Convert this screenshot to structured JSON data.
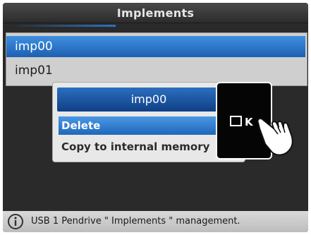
{
  "header": {
    "title": "Implements"
  },
  "list": {
    "items": [
      {
        "label": "imp00",
        "selected": true
      },
      {
        "label": "imp01",
        "selected": false
      }
    ]
  },
  "popup": {
    "title": "imp00",
    "options": [
      {
        "label": "Delete",
        "selected": true
      },
      {
        "label": "Copy to internal memory",
        "selected": false
      }
    ]
  },
  "ok_key": {
    "label": "K",
    "icon": "box-o-icon"
  },
  "status": {
    "icon": "info-icon",
    "text": "USB 1 Pendrive \" Implements \" management."
  },
  "colors": {
    "accent": "#1c5fb2",
    "background": "#2a2a2a",
    "popup": "#e8e8e8"
  }
}
